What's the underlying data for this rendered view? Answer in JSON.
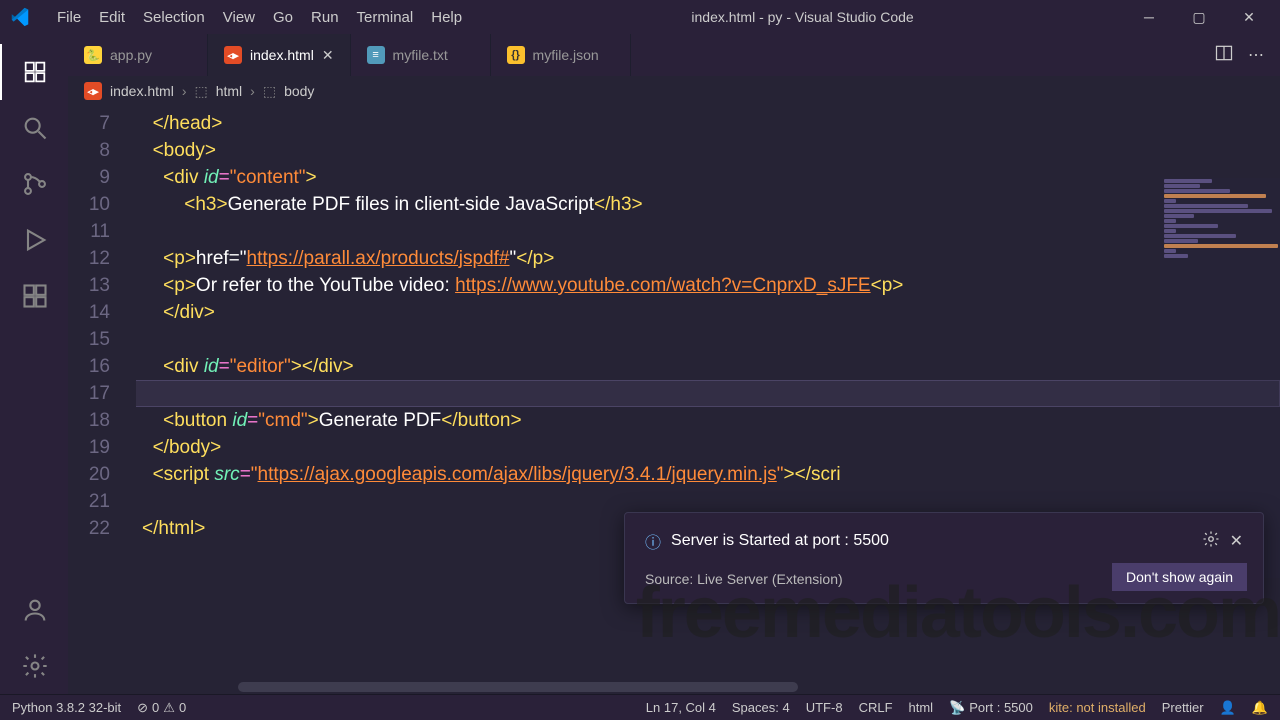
{
  "title": "index.html - py - Visual Studio Code",
  "menu": [
    "File",
    "Edit",
    "Selection",
    "View",
    "Go",
    "Run",
    "Terminal",
    "Help"
  ],
  "tabs": [
    {
      "label": "app.py",
      "icon": "py"
    },
    {
      "label": "index.html",
      "icon": "html",
      "active": true,
      "dirty": false
    },
    {
      "label": "myfile.txt",
      "icon": "txt"
    },
    {
      "label": "myfile.json",
      "icon": "json"
    }
  ],
  "breadcrumbs": {
    "file": "index.html",
    "sym1": "html",
    "sym2": "body"
  },
  "gutter_start": 7,
  "code": {
    "l7": {
      "indent": 1,
      "tag_close": "head"
    },
    "l8": {
      "indent": 1,
      "tag_open": "body"
    },
    "l9": {
      "indent": 2,
      "tag": "div",
      "attr": "id",
      "val": "content"
    },
    "l10": {
      "indent": 4,
      "tag": "h3",
      "text": "Generate PDF files in client-side JavaScript"
    },
    "l12": {
      "indent": 2,
      "tag": "p",
      "text_pre": "href=\"",
      "link": "https://parall.ax/products/jspdf#",
      "text_post": "\""
    },
    "l13": {
      "indent": 2,
      "tag": "p",
      "text_pre": "Or refer to the YouTube video: ",
      "link": "https://www.youtube.com/watch?v=CnprxD_sJFE",
      "trail_tag": "p"
    },
    "l14": {
      "indent": 2,
      "tag_close": "div"
    },
    "l16": {
      "indent": 2,
      "tag": "div",
      "attr": "id",
      "val": "editor",
      "self_close": true
    },
    "l18": {
      "indent": 2,
      "tag": "button",
      "attr": "id",
      "val": "cmd",
      "text": "Generate PDF"
    },
    "l19": {
      "indent": 1,
      "tag_close": "body"
    },
    "l20": {
      "indent": 1,
      "tag": "script",
      "attr": "src",
      "link": "https://ajax.googleapis.com/ajax/libs/jquery/3.4.1/jquery.min.js",
      "trail": "></scri"
    },
    "l22": {
      "indent": 0,
      "tag_close": "html"
    }
  },
  "notification": {
    "message": "Server is Started at port : 5500",
    "source": "Source: Live Server (Extension)",
    "button": "Don't show again"
  },
  "statusbar": {
    "python": "Python 3.8.2 32-bit",
    "errors": "0",
    "warnings": "0",
    "cursor": "Ln 17, Col 4",
    "spaces": "Spaces: 4",
    "encoding": "UTF-8",
    "eol": "CRLF",
    "lang": "html",
    "port": "Port : 5500",
    "kite": "kite: not installed",
    "prettier": "Prettier"
  },
  "watermark": "freemediatools.com"
}
